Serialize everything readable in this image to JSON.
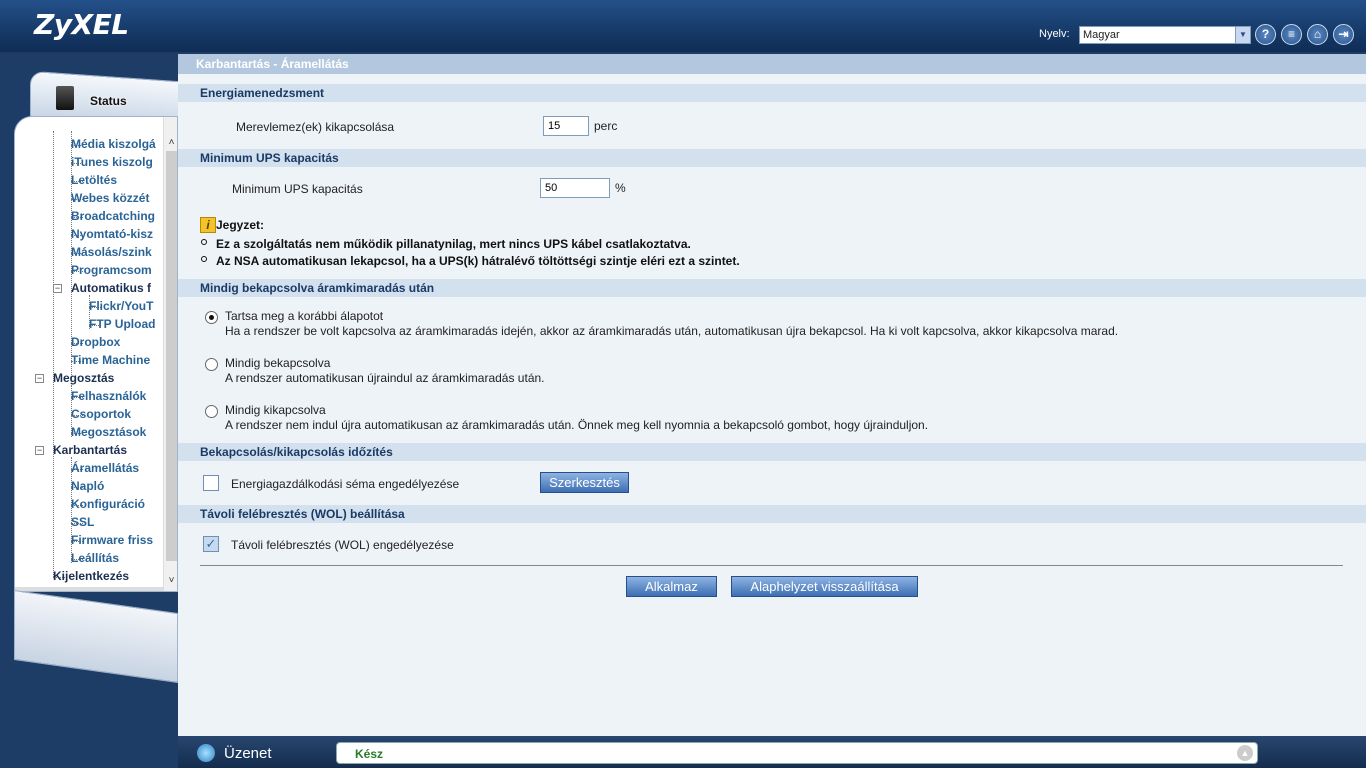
{
  "header": {
    "logo": "ZyXEL",
    "language_label": "Nyelv:",
    "language_value": "Magyar"
  },
  "nav": {
    "status_label": "Status",
    "items": [
      {
        "label": "Média kiszolgá"
      },
      {
        "label": "iTunes kiszolg"
      },
      {
        "label": "Letöltés"
      },
      {
        "label": "Webes közzét"
      },
      {
        "label": "Broadcatching"
      },
      {
        "label": "Nyomtató-kisz"
      },
      {
        "label": "Másolás/szink"
      },
      {
        "label": "Programcsom"
      },
      {
        "label": "Automatikus f"
      },
      {
        "label": "Flickr/YouT"
      },
      {
        "label": "FTP Upload"
      },
      {
        "label": "Dropbox"
      },
      {
        "label": "Time Machine"
      },
      {
        "label": "Megosztás"
      },
      {
        "label": "Felhasználók"
      },
      {
        "label": "Csoportok"
      },
      {
        "label": "Megosztások"
      },
      {
        "label": "Karbantartás"
      },
      {
        "label": "Áramellátás"
      },
      {
        "label": "Napló"
      },
      {
        "label": "Konfiguráció"
      },
      {
        "label": "SSL"
      },
      {
        "label": "Firmware friss"
      },
      {
        "label": "Leállítás"
      },
      {
        "label": "Kijelentkezés"
      }
    ]
  },
  "main": {
    "title": "Karbantartás - Áramellátás",
    "energy": {
      "heading": "Energiamenedzsment",
      "label": "Merevlemez(ek) kikapcsolása",
      "value": "15",
      "unit": "perc"
    },
    "ups": {
      "heading": "Minimum UPS kapacitás",
      "label": "Minimum UPS kapacitás",
      "value": "50",
      "unit": "%"
    },
    "note": {
      "title": "Jegyzet:",
      "lines": [
        "Ez a szolgáltatás nem működik pillanatynilag, mert nincs UPS kábel csatlakoztatva.",
        "Az NSA automatikusan lekapcsol, ha a UPS(k) hátralévő töltöttségi szintje eléri ezt a szintet."
      ]
    },
    "power_restore": {
      "heading": "Mindig bekapcsolva áramkimaradás után",
      "options": [
        {
          "title": "Tartsa meg a korábbi álapotot",
          "desc": "Ha a rendszer be volt kapcsolva az áramkimaradás idején, akkor az áramkimaradás után, automatikusan újra bekapcsol. Ha ki volt kapcsolva, akkor kikapcsolva marad.",
          "selected": true
        },
        {
          "title": "Mindig bekapcsolva",
          "desc": "A rendszer automatikusan újraindul az áramkimaradás után.",
          "selected": false
        },
        {
          "title": "Mindig kikapcsolva",
          "desc": "A rendszer nem indul újra automatikusan az áramkimaradás után. Önnek meg kell nyomnia a bekapcsoló gombot, hogy újrainduljon.",
          "selected": false
        }
      ]
    },
    "schedule": {
      "heading": "Bekapcsolás/kikapcsolás időzítés",
      "checkbox_label": "Energiagazdálkodási séma engedélyezése",
      "checked": false,
      "edit_button": "Szerkesztés"
    },
    "wol": {
      "heading": "Távoli felébresztés (WOL) beállítása",
      "checkbox_label": "Távoli felébresztés (WOL) engedélyezése",
      "checked": true
    },
    "buttons": {
      "apply": "Alkalmaz",
      "reset": "Alaphelyzet visszaállítása"
    }
  },
  "footer": {
    "label": "Üzenet",
    "message": "Kész"
  }
}
